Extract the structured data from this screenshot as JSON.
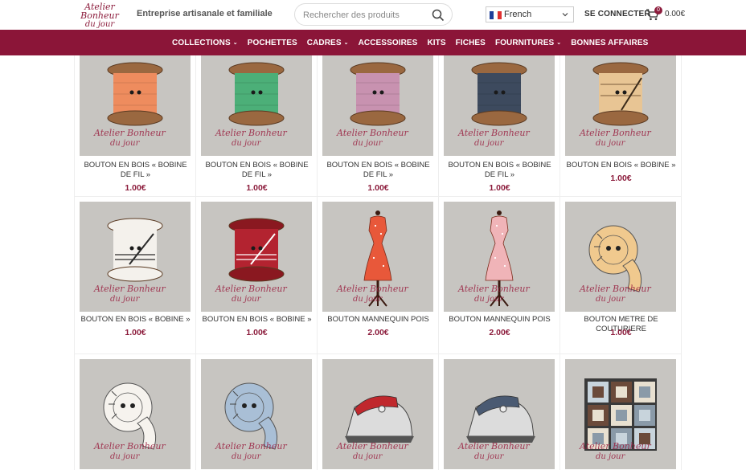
{
  "header": {
    "logo_line1": "Atelier Bonheur",
    "logo_line2": "du jour",
    "tagline": "Entreprise artisanale et familiale",
    "search_placeholder": "Rechercher des produits",
    "language": "French",
    "login": "SE CONNECTER",
    "cart_count": "0",
    "cart_total": "0.00€"
  },
  "nav": {
    "items": [
      {
        "label": "COLLECTIONS",
        "dropdown": true
      },
      {
        "label": "POCHETTES",
        "dropdown": false
      },
      {
        "label": "CADRES",
        "dropdown": true
      },
      {
        "label": "ACCESSOIRES",
        "dropdown": false
      },
      {
        "label": "KITS",
        "dropdown": false
      },
      {
        "label": "FICHES",
        "dropdown": false
      },
      {
        "label": "FOURNITURES",
        "dropdown": true
      },
      {
        "label": "BONNES AFFAIRES",
        "dropdown": false
      }
    ]
  },
  "watermark": {
    "line1": "Atelier Bonheur",
    "line2": "du jour"
  },
  "products": [
    {
      "title": "BOUTON EN BOIS « BOBINE DE FIL »",
      "price": "1.00€",
      "kind": "spool",
      "color": "#ee8c5e"
    },
    {
      "title": "BOUTON EN BOIS « BOBINE DE FIL »",
      "price": "1.00€",
      "kind": "spool",
      "color": "#4caf78"
    },
    {
      "title": "BOUTON EN BOIS « BOBINE DE FIL »",
      "price": "1.00€",
      "kind": "spool",
      "color": "#c892b0"
    },
    {
      "title": "BOUTON EN BOIS « BOBINE DE FIL »",
      "price": "1.00€",
      "kind": "spool",
      "color": "#3d4a5e"
    },
    {
      "title": "BOUTON EN BOIS « BOBINE »",
      "price": "1.00€",
      "kind": "spool-wood",
      "color": "#e8c594"
    },
    {
      "title": "BOUTON EN BOIS « BOBINE »",
      "price": "1.00€",
      "kind": "spool-white",
      "color": "#f4f1ec"
    },
    {
      "title": "BOUTON EN BOIS « BOBINE »",
      "price": "1.00€",
      "kind": "spool-red",
      "color": "#b32330"
    },
    {
      "title": "BOUTON MANNEQUIN POIS",
      "price": "2.00€",
      "kind": "mannequin",
      "color": "#e8583a"
    },
    {
      "title": "BOUTON MANNEQUIN POIS",
      "price": "2.00€",
      "kind": "mannequin",
      "color": "#f0b4b8"
    },
    {
      "title": "BOUTON METRE DE COUTURIERE",
      "price": "1.00€",
      "kind": "tape",
      "color": "#f0c98e"
    },
    {
      "title": "",
      "price": "",
      "kind": "tape",
      "color": "#f6f3ee"
    },
    {
      "title": "",
      "price": "",
      "kind": "tape",
      "color": "#a9bfd6"
    },
    {
      "title": "",
      "price": "",
      "kind": "iron",
      "color": "#c0282d"
    },
    {
      "title": "",
      "price": "",
      "kind": "iron",
      "color": "#4a5a72"
    },
    {
      "title": "",
      "price": "",
      "kind": "quilt",
      "color": "#6b4a3a"
    }
  ]
}
